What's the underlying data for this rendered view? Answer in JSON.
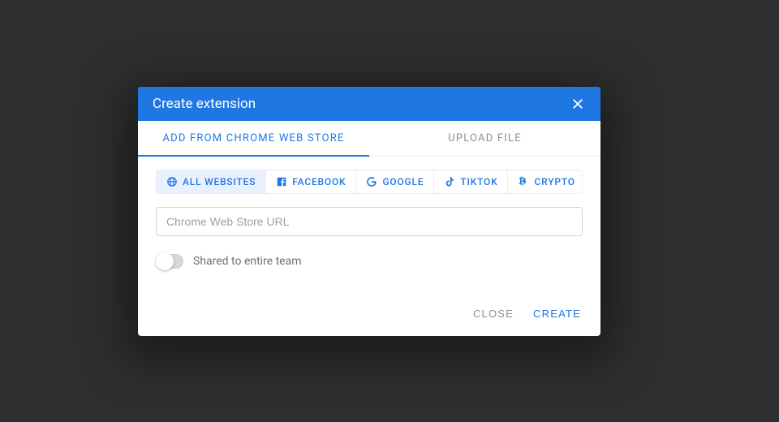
{
  "modal": {
    "title": "Create extension",
    "tabs": [
      {
        "label": "ADD FROM CHROME WEB STORE",
        "active": true
      },
      {
        "label": "UPLOAD FILE",
        "active": false
      }
    ],
    "categories": [
      {
        "label": "ALL WEBSITES",
        "icon": "globe",
        "selected": true
      },
      {
        "label": "FACEBOOK",
        "icon": "facebook",
        "selected": false
      },
      {
        "label": "GOOGLE",
        "icon": "google",
        "selected": false
      },
      {
        "label": "TIKTOK",
        "icon": "tiktok",
        "selected": false
      },
      {
        "label": "CRYPTO",
        "icon": "crypto",
        "selected": false
      }
    ],
    "url_placeholder": "Chrome Web Store URL",
    "url_value": "",
    "share_toggle": {
      "label": "Shared to entire team",
      "on": false
    },
    "footer": {
      "close": "CLOSE",
      "create": "CREATE"
    }
  },
  "colors": {
    "primary": "#1f77e3",
    "muted": "#8a8f97"
  }
}
